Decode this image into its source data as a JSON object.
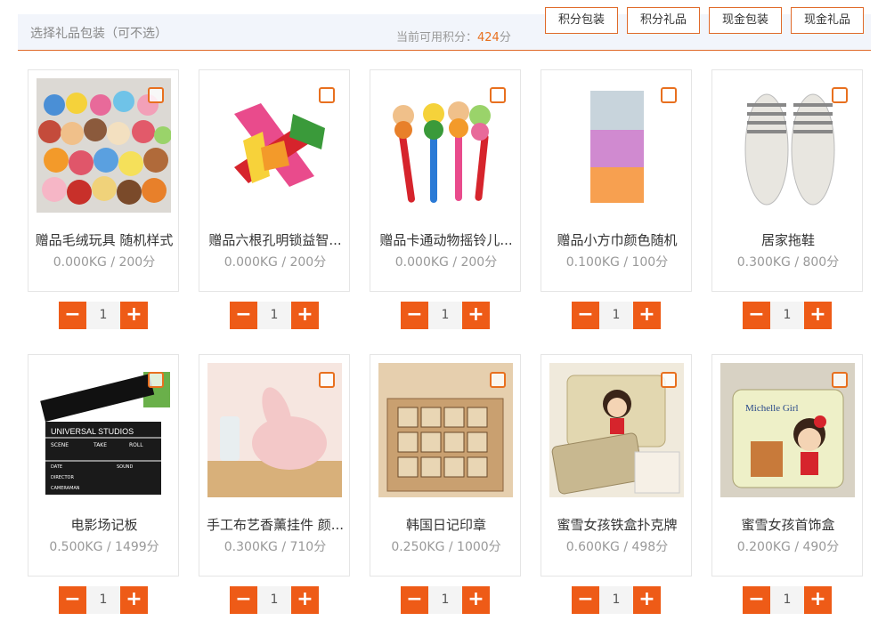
{
  "header": {
    "hint": "选择礼品包装（可不选）",
    "points_label": "当前可用积分：",
    "points_value": "424",
    "points_unit": "分"
  },
  "tabs": [
    {
      "label": "积分包装"
    },
    {
      "label": "积分礼品"
    },
    {
      "label": "现金包装"
    },
    {
      "label": "现金礼品"
    }
  ],
  "colors": {
    "accent": "#ee5b17",
    "border": "#e06a2a"
  },
  "products": [
    {
      "name": "赠品毛绒玩具 随机样式",
      "meta": "0.000KG / 200分",
      "qty": "1",
      "image": "plush-toys"
    },
    {
      "name": "赠品六根孔明锁益智...",
      "meta": "0.000KG / 200分",
      "qty": "1",
      "image": "wooden-puzzle"
    },
    {
      "name": "赠品卡通动物摇铃儿...",
      "meta": "0.000KG / 200分",
      "qty": "1",
      "image": "rattles"
    },
    {
      "name": "赠品小方巾颜色随机",
      "meta": "0.100KG / 100分",
      "qty": "1",
      "image": "towels"
    },
    {
      "name": "居家拖鞋",
      "meta": "0.300KG / 800分",
      "qty": "1",
      "image": "slippers"
    },
    {
      "name": "电影场记板",
      "meta": "0.500KG / 1499分",
      "qty": "1",
      "image": "clapperboard"
    },
    {
      "name": "手工布艺香薰挂件 颜...",
      "meta": "0.300KG / 710分",
      "qty": "1",
      "image": "fabric-rabbit"
    },
    {
      "name": "韩国日记印章",
      "meta": "0.250KG / 1000分",
      "qty": "1",
      "image": "stamps"
    },
    {
      "name": "蜜雪女孩铁盒扑克牌",
      "meta": "0.600KG / 498分",
      "qty": "1",
      "image": "tin-cards"
    },
    {
      "name": "蜜雪女孩首饰盒",
      "meta": "0.200KG / 490分",
      "qty": "1",
      "image": "jewelry-box",
      "box_text": "Michelle Girl"
    }
  ],
  "clapper_text": [
    "UNIVERSAL STUDIOS",
    "SCENE",
    "TAKE",
    "ROLL",
    "DATE",
    "SOUND",
    "DIRECTOR",
    "CAMERAMAN"
  ]
}
